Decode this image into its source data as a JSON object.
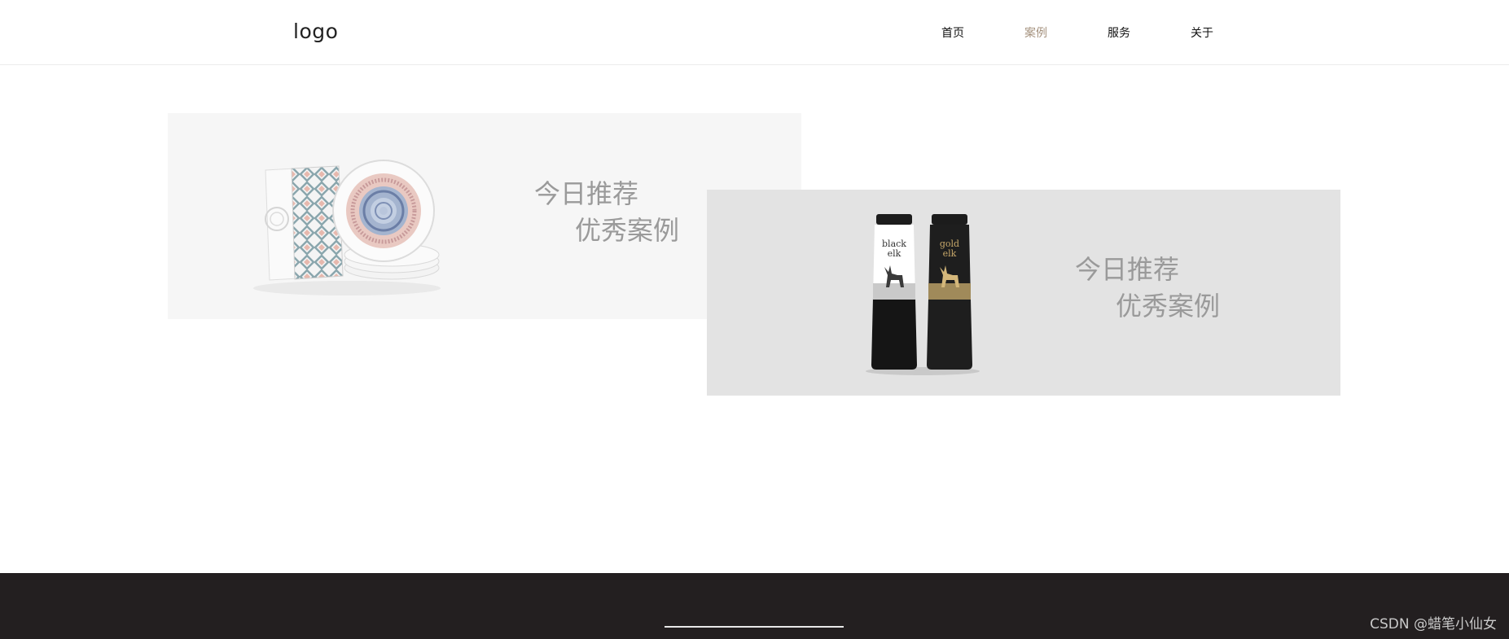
{
  "header": {
    "logo": "logo",
    "nav": [
      {
        "label": "首页",
        "active": false
      },
      {
        "label": "案例",
        "active": true
      },
      {
        "label": "服务",
        "active": false
      },
      {
        "label": "关于",
        "active": false
      }
    ]
  },
  "cards": [
    {
      "line1": "今日推荐",
      "line2": "优秀案例",
      "image": "plate-gift-box-image"
    },
    {
      "line1": "今日推荐",
      "line2": "优秀案例",
      "image": "black-gold-elk-bottles-image"
    }
  ],
  "footer": {
    "watermark": "CSDN @蜡笔小仙女"
  },
  "colors": {
    "accent": "#a4917d",
    "footer_bg": "#231f20",
    "card1_bg": "#f6f6f6",
    "card2_bg": "#e3e3e3"
  }
}
